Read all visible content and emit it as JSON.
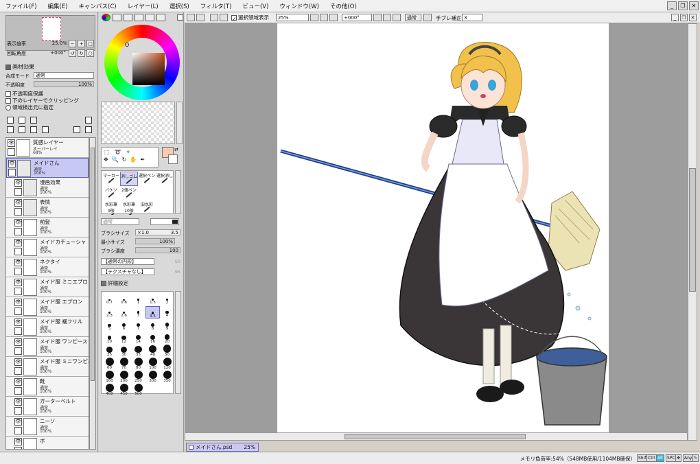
{
  "menu": [
    "ファイル(F)",
    "編集(E)",
    "キャンバス(C)",
    "レイヤー(L)",
    "選択(S)",
    "フィルタ(T)",
    "ビュー(V)",
    "ウィンドウ(W)",
    "その他(O)"
  ],
  "navigator": {
    "zoom_label": "表示倍率",
    "zoom_value": "25.0%",
    "rotate_label": "回転角度",
    "rotate_value": "+000°"
  },
  "layer_effects": {
    "header": "画材効果",
    "blend_label": "合成モード",
    "blend_value": "通常",
    "opacity_label": "不透明度",
    "opacity_value": "100%",
    "options": [
      "不透明度保護",
      "下のレイヤーでクリッピング",
      "領域検出元に指定"
    ]
  },
  "layers": [
    {
      "name": "質感レイヤー",
      "mode": "オーバーレイ",
      "opacity": "68%",
      "folder": false,
      "indent": false,
      "selected": false
    },
    {
      "name": "メイドさん",
      "mode": "通常",
      "opacity": "100%",
      "folder": true,
      "indent": false,
      "selected": true
    },
    {
      "name": "漫画効果",
      "mode": "通常",
      "opacity": "100%",
      "folder": true,
      "indent": true,
      "selected": false
    },
    {
      "name": "表情",
      "mode": "通常",
      "opacity": "100%",
      "folder": true,
      "indent": true,
      "selected": false
    },
    {
      "name": "前髪",
      "mode": "通常",
      "opacity": "100%",
      "folder": false,
      "indent": true,
      "selected": false
    },
    {
      "name": "メイドカチューシャ",
      "mode": "通常",
      "opacity": "100%",
      "folder": false,
      "indent": true,
      "selected": false
    },
    {
      "name": "ネクタイ",
      "mode": "通常",
      "opacity": "100%",
      "folder": false,
      "indent": true,
      "selected": false
    },
    {
      "name": "メイド服 ミニエプロン",
      "mode": "通常",
      "opacity": "100%",
      "folder": false,
      "indent": true,
      "selected": false
    },
    {
      "name": "メイド服 エプロン",
      "mode": "通常",
      "opacity": "100%",
      "folder": false,
      "indent": true,
      "selected": false
    },
    {
      "name": "メイド服 裾フリル",
      "mode": "通常",
      "opacity": "100%",
      "folder": false,
      "indent": true,
      "selected": false
    },
    {
      "name": "メイド服 ワンピース",
      "mode": "通常",
      "opacity": "100%",
      "folder": false,
      "indent": true,
      "selected": false
    },
    {
      "name": "メイド服 ミニワンピ...",
      "mode": "通常",
      "opacity": "100%",
      "folder": false,
      "indent": true,
      "selected": false
    },
    {
      "name": "靴",
      "mode": "通常",
      "opacity": "100%",
      "folder": false,
      "indent": true,
      "selected": false
    },
    {
      "name": "ガーターベルト",
      "mode": "通常",
      "opacity": "100%",
      "folder": false,
      "indent": true,
      "selected": false
    },
    {
      "name": "ニーソ",
      "mode": "通常",
      "opacity": "100%",
      "folder": false,
      "indent": true,
      "selected": false
    },
    {
      "name": "ボ",
      "mode": "",
      "opacity": "",
      "folder": false,
      "indent": true,
      "selected": false
    }
  ],
  "brush_tools": [
    {
      "label": "マーカー",
      "selected": false
    },
    {
      "label": "消しゴム",
      "selected": true
    },
    {
      "label": "選択ペン",
      "selected": false
    },
    {
      "label": "選択消し",
      "selected": false
    },
    {
      "label": "バケツ",
      "selected": false
    },
    {
      "label": "2値ペン",
      "selected": false
    },
    {
      "label": "",
      "selected": false
    },
    {
      "label": "",
      "selected": false
    },
    {
      "label": "水彩筆",
      "sub": "9般",
      "selected": false
    },
    {
      "label": "水彩筆",
      "sub": "10般",
      "selected": false
    },
    {
      "label": "旧水彩",
      "selected": false
    },
    {
      "label": "",
      "selected": false
    }
  ],
  "brush_settings": {
    "mode_value": "通常",
    "size_label": "ブラシサイズ",
    "size_mult": "×1.0",
    "size_value": "3.5",
    "min_size_label": "最小サイズ",
    "min_size_value": "100%",
    "density_label": "ブラシ濃度",
    "density_value": "100",
    "shape_value": "【通常の円形】",
    "shape_num": "50",
    "texture_value": "【テクスチャなし】",
    "texture_num": "95",
    "detail_label": "詳細設定"
  },
  "brush_tips": [
    "0.7",
    "0.8",
    "1",
    "1.5",
    "2",
    "2.3",
    "2.6",
    "3",
    "3.5",
    "4",
    "5",
    "6",
    "7",
    "8",
    "9",
    "10",
    "12",
    "14",
    "16",
    "20",
    "25",
    "30",
    "35",
    "40",
    "50",
    "60",
    "70",
    "80",
    "100",
    "120",
    "160",
    "200",
    "250",
    "300",
    "350",
    "400",
    "450",
    "500"
  ],
  "selected_tip": "3.5",
  "toolbar": {
    "selection_show": "選択領域表示",
    "zoom": "25%",
    "rotation": "+000°",
    "normal": "通常",
    "stabilizer_label": "手ブレ補正",
    "stabilizer_value": "3"
  },
  "document_tab": {
    "name": "メイドさん.psd",
    "zoom": "25%"
  },
  "status": {
    "memory": "メモリ負荷率:54%（548MB使用/1104MB確保）",
    "badges": [
      "Shift",
      "Ctrl",
      "Alt",
      "SPC",
      "✥",
      "Any",
      "✎"
    ]
  },
  "colors": {
    "accent": "#6060c0",
    "selection": "#c8c8f4",
    "foreground": "#f8cbb0"
  }
}
